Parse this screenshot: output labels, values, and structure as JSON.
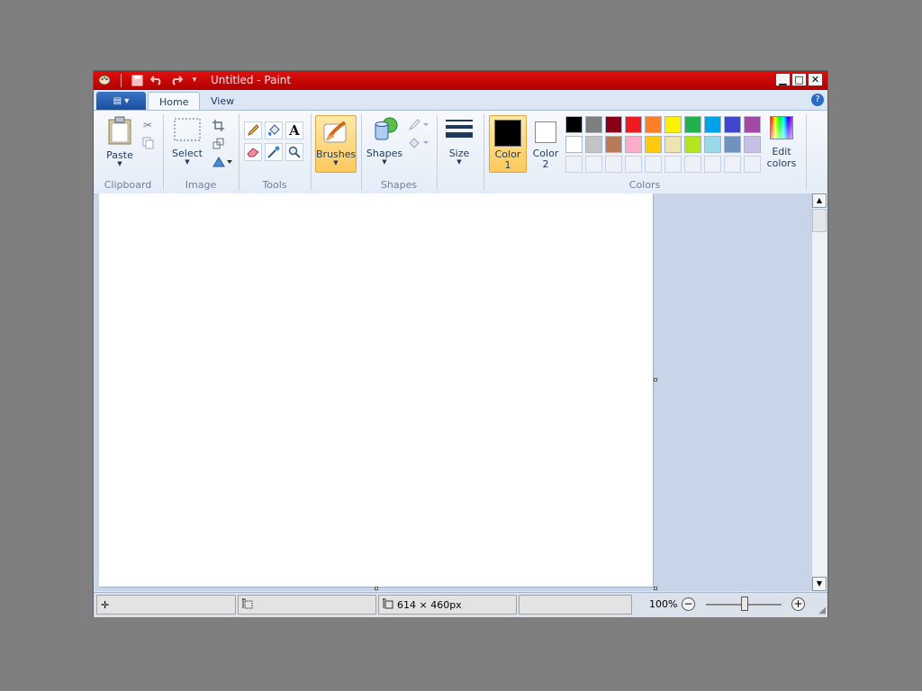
{
  "window": {
    "title": "Untitled - Paint"
  },
  "quick_access": {
    "more": "▾"
  },
  "window_buttons": {
    "minimize": "▁",
    "maximize": "□",
    "close": "✕"
  },
  "tabs": {
    "file": "▤ ▾",
    "home": "Home",
    "view": "View",
    "help": "?"
  },
  "ribbon": {
    "clipboard": {
      "group_label": "Clipboard",
      "paste": "Paste"
    },
    "image": {
      "group_label": "Image",
      "select": "Select"
    },
    "tools": {
      "group_label": "Tools"
    },
    "brushes": {
      "label": "Brushes"
    },
    "shapes": {
      "group_label": "Shapes",
      "label": "Shapes"
    },
    "size": {
      "label": "Size"
    },
    "colors": {
      "group_label": "Colors",
      "color1_label": "Color\n1",
      "color1_line1": "Color",
      "color1_line2": "1",
      "color2_line1": "Color",
      "color2_line2": "2",
      "color1_value": "#000000",
      "color2_value": "#ffffff",
      "edit_line1": "Edit",
      "edit_line2": "colors",
      "palette_row1": [
        "#000000",
        "#7f7f7f",
        "#880015",
        "#ed1c24",
        "#ff7f27",
        "#fff200",
        "#22b14c",
        "#00a2e8",
        "#3f48cc",
        "#a349a4"
      ],
      "palette_row2": [
        "#ffffff",
        "#c3c3c3",
        "#b97a57",
        "#ffaec9",
        "#ffc90e",
        "#efe4b0",
        "#b5e61d",
        "#99d9ea",
        "#7092be",
        "#c8bfe7"
      ]
    }
  },
  "status": {
    "image_size": "614 × 460px",
    "zoom": "100%"
  },
  "accent": "#cc0000"
}
